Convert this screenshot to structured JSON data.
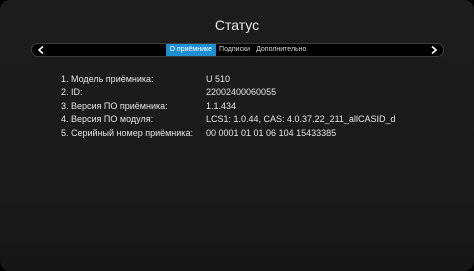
{
  "header": {
    "title": "Статус"
  },
  "tabs": {
    "items": [
      {
        "label": "О приёмнике",
        "active": true
      },
      {
        "label": "Подписки",
        "active": false
      },
      {
        "label": "Дополнительно",
        "active": false
      }
    ],
    "left_icon": "chevron-left-icon",
    "right_icon": "chevron-right-icon"
  },
  "info": [
    {
      "label": "1. Модель приёмника:",
      "value": "U 510"
    },
    {
      "label": "2. ID:",
      "value": "22002400060055"
    },
    {
      "label": "3. Версия ПО приёмника:",
      "value": "1.1.434"
    },
    {
      "label": "4. Версия ПО модуля:",
      "value": "LCS1: 1.0.44, CAS: 4.0.37.22_211_allCASID_d"
    },
    {
      "label": "5. Серийный номер приёмника:",
      "value": "00 0001 01 01 06 104 15433385"
    }
  ],
  "colors": {
    "accent": "#1e8fd5",
    "background": "#1c1c1c",
    "text": "#e6e6e6"
  }
}
